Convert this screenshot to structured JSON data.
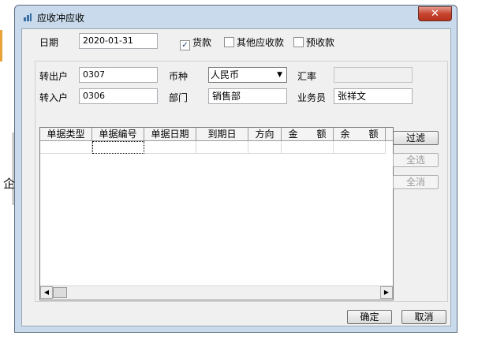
{
  "background": {
    "partial_char": "企"
  },
  "window": {
    "title": "应收冲应收",
    "close_glyph": "✕"
  },
  "date": {
    "label": "日期",
    "value": "2020-01-31"
  },
  "checkboxes": [
    {
      "label": "货款",
      "checked": true,
      "mark": "✓"
    },
    {
      "label": "其他应收款",
      "checked": false,
      "mark": ""
    },
    {
      "label": "预收款",
      "checked": false,
      "mark": ""
    }
  ],
  "form": {
    "out_label": "转出户",
    "out_value": "0307",
    "in_label": "转入户",
    "in_value": "0306",
    "currency_label": "币种",
    "currency_value": "人民币",
    "rate_label": "汇率",
    "rate_value": "",
    "dept_label": "部门",
    "dept_value": "销售部",
    "clerk_label": "业务员",
    "clerk_value": "张祥文"
  },
  "grid": {
    "columns": [
      "单据类型",
      "单据编号",
      "单据日期",
      "到期日",
      "方向",
      "金　　额",
      "余　　额",
      ""
    ]
  },
  "side_buttons": {
    "filter": "过滤",
    "select_all": "全选",
    "clear_all": "全消"
  },
  "footer": {
    "ok": "确定",
    "cancel": "取消"
  }
}
